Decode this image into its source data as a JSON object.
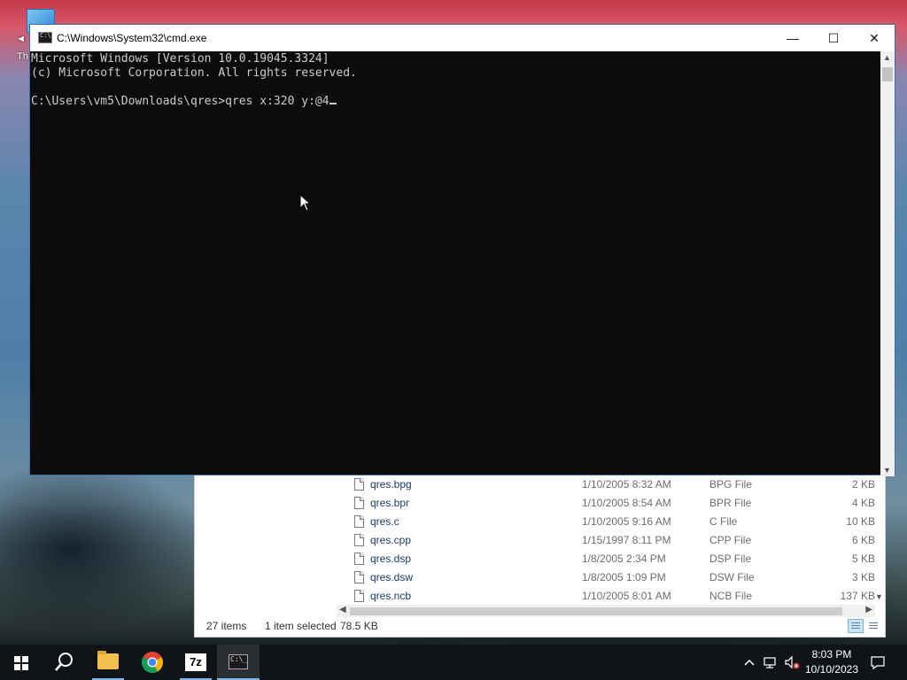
{
  "desktop": {
    "icon_label": "Th",
    "icon_arrow": "◄"
  },
  "cmd": {
    "title": "C:\\Windows\\System32\\cmd.exe",
    "lines": [
      "Microsoft Windows [Version 10.0.19045.3324]",
      "(c) Microsoft Corporation. All rights reserved.",
      "",
      "C:\\Users\\vm5\\Downloads\\qres>qres x:320 y:@4"
    ],
    "buttons": {
      "minimize": "—",
      "maximize": "☐",
      "close": "✕"
    }
  },
  "explorer": {
    "files": [
      {
        "name": "qres.bpg",
        "date": "1/10/2005 8:32 AM",
        "type": "BPG File",
        "size": "2 KB"
      },
      {
        "name": "qres.bpr",
        "date": "1/10/2005 8:54 AM",
        "type": "BPR File",
        "size": "4 KB"
      },
      {
        "name": "qres.c",
        "date": "1/10/2005 9:16 AM",
        "type": "C File",
        "size": "10 KB"
      },
      {
        "name": "qres.cpp",
        "date": "1/15/1997 8:11 PM",
        "type": "CPP File",
        "size": "6 KB"
      },
      {
        "name": "qres.dsp",
        "date": "1/8/2005 2:34 PM",
        "type": "DSP File",
        "size": "5 KB"
      },
      {
        "name": "qres.dsw",
        "date": "1/8/2005 1:09 PM",
        "type": "DSW File",
        "size": "3 KB"
      },
      {
        "name": "qres.ncb",
        "date": "1/10/2005 8:01 AM",
        "type": "NCB File",
        "size": "137 KB"
      }
    ],
    "status": {
      "item_count": "27 items",
      "selected": "1 item selected",
      "selected_size": "78.5 KB"
    }
  },
  "taskbar": {
    "apps": [
      {
        "name": "start",
        "icon": "windows-logo-icon"
      },
      {
        "name": "search",
        "icon": "search-icon"
      },
      {
        "name": "file-explorer",
        "icon": "folder-icon"
      },
      {
        "name": "chrome",
        "icon": "chrome-icon"
      },
      {
        "name": "7-zip",
        "icon": "7zip-icon",
        "label": "7z"
      },
      {
        "name": "command-prompt",
        "icon": "cmd-icon"
      }
    ],
    "tray": {
      "time": "8:03 PM",
      "date": "10/10/2023"
    }
  }
}
